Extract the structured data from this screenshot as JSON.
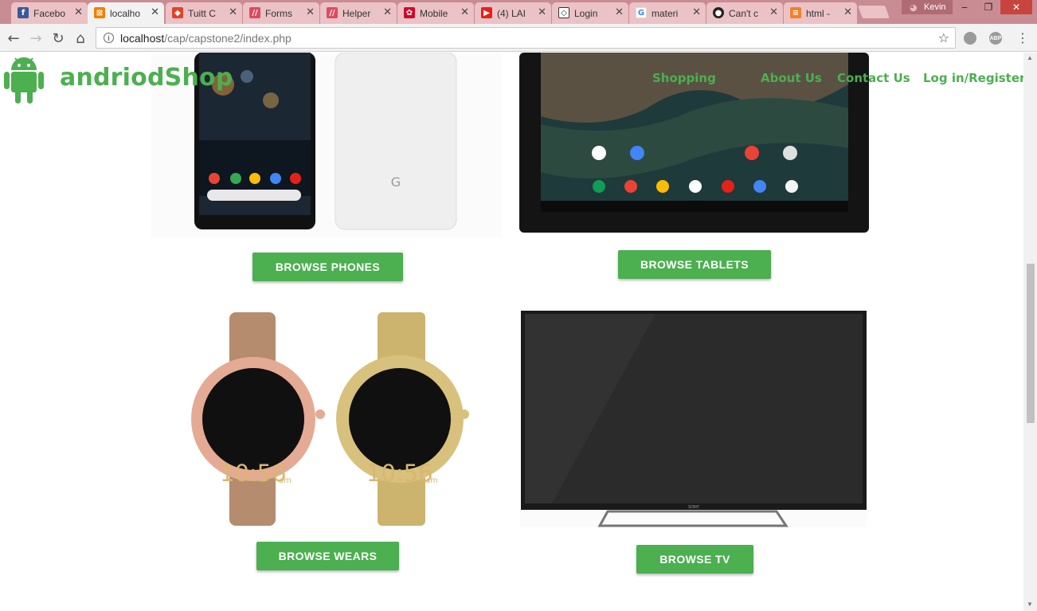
{
  "browser": {
    "tabs": [
      {
        "title": "Facebo",
        "favicon": "facebook-icon",
        "color": "#3b5998"
      },
      {
        "title": "localho",
        "favicon": "xampp-icon",
        "color": "#f57c00",
        "active": true
      },
      {
        "title": "Tuitt C",
        "favicon": "gitlab-icon",
        "color": "#e24329"
      },
      {
        "title": "Forms",
        "favicon": "ii-icon",
        "color": "#e04a5f"
      },
      {
        "title": "Helper",
        "favicon": "ii-icon",
        "color": "#e04a5f"
      },
      {
        "title": "Mobile",
        "favicon": "huawei-icon",
        "color": "#cf0a2c"
      },
      {
        "title": "(4) LAI",
        "favicon": "youtube-icon",
        "color": "#e62117"
      },
      {
        "title": "Login",
        "favicon": "codepen-icon",
        "color": "#333333"
      },
      {
        "title": "materi",
        "favicon": "google-icon",
        "color": "#4285f4"
      },
      {
        "title": "Can't c",
        "favicon": "github-icon",
        "color": "#222222"
      },
      {
        "title": "html -",
        "favicon": "stackoverflow-icon",
        "color": "#f48024"
      }
    ],
    "profile_name": "Kevin",
    "url_host": "localhost",
    "url_path": "/cap/capstone2/index.php",
    "extension_abp": "ABP"
  },
  "site": {
    "brand": "andriodShop",
    "accent": "#4caf50",
    "nav": [
      "Shopping",
      "About Us",
      "Contact Us",
      "Log in/Register"
    ]
  },
  "products": [
    {
      "name": "phones-image",
      "button": "BROWSE PHONES"
    },
    {
      "name": "tablets-image",
      "button": "BROWSE TABLETS"
    },
    {
      "name": "wears-image",
      "button": "BROWSE WEARS",
      "watch_time": "10:56",
      "watch_suffix": "am"
    },
    {
      "name": "tv-image",
      "button": "BROWSE TV",
      "tv_brand": "SONY"
    }
  ]
}
